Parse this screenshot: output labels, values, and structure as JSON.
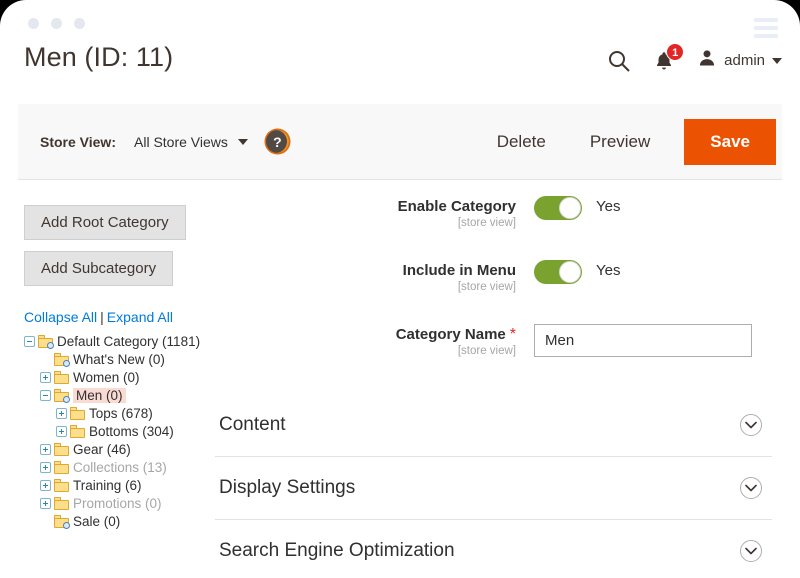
{
  "window": {
    "traffic_dots": 3,
    "menu_icon": "hamburger-icon"
  },
  "header": {
    "title": "Men (ID: 11)",
    "search_icon": "search-icon",
    "notifications_icon": "bell-icon",
    "notifications_count": "1",
    "user_icon": "user-avatar-icon",
    "user_name": "admin",
    "user_caret": "chevron-down-icon"
  },
  "storeview": {
    "label": "Store View:",
    "value": "All Store Views",
    "help_icon": "question-mark-icon",
    "help_glyph": "?",
    "delete_label": "Delete",
    "preview_label": "Preview",
    "save_label": "Save",
    "save_color": "#eb5202"
  },
  "sidebar": {
    "add_root_label": "Add Root Category",
    "add_sub_label": "Add Subcategory",
    "collapse_all": "Collapse All",
    "separator": "|",
    "expand_all": "Expand All",
    "tree": [
      {
        "label": "Default Category (1181)",
        "depth": 0,
        "expander": "minus",
        "icon": "folder-search-icon",
        "selected": false,
        "disabled": false
      },
      {
        "label": "What's New (0)",
        "depth": 1,
        "expander": "none",
        "icon": "folder-search-icon",
        "selected": false,
        "disabled": false
      },
      {
        "label": "Women (0)",
        "depth": 1,
        "expander": "plus",
        "icon": "folder-icon",
        "selected": false,
        "disabled": false
      },
      {
        "label": "Men (0)",
        "depth": 1,
        "expander": "minus",
        "icon": "folder-search-icon",
        "selected": true,
        "disabled": false
      },
      {
        "label": "Tops (678)",
        "depth": 2,
        "expander": "plus",
        "icon": "folder-icon",
        "selected": false,
        "disabled": false
      },
      {
        "label": "Bottoms (304)",
        "depth": 2,
        "expander": "plus",
        "icon": "folder-icon",
        "selected": false,
        "disabled": false
      },
      {
        "label": "Gear (46)",
        "depth": 1,
        "expander": "plus",
        "icon": "folder-icon",
        "selected": false,
        "disabled": false
      },
      {
        "label": "Collections (13)",
        "depth": 1,
        "expander": "plus",
        "icon": "folder-icon",
        "selected": false,
        "disabled": true
      },
      {
        "label": "Training (6)",
        "depth": 1,
        "expander": "plus",
        "icon": "folder-icon",
        "selected": false,
        "disabled": false
      },
      {
        "label": "Promotions (0)",
        "depth": 1,
        "expander": "plus",
        "icon": "folder-icon",
        "selected": false,
        "disabled": true
      },
      {
        "label": "Sale (0)",
        "depth": 1,
        "expander": "none",
        "icon": "folder-search-icon",
        "selected": false,
        "disabled": false
      }
    ],
    "selected_highlight": "#fadbd3"
  },
  "form": {
    "enable_category": {
      "label": "Enable Category",
      "scope": "[store view]",
      "value": "Yes",
      "on": true
    },
    "include_in_menu": {
      "label": "Include in Menu",
      "scope": "[store view]",
      "value": "Yes",
      "on": true
    },
    "category_name": {
      "label": "Category Name",
      "required_marker": "*",
      "scope": "[store view]",
      "value": "Men",
      "placeholder": ""
    },
    "toggle_on_color": "#79a22e"
  },
  "sections": [
    {
      "title": "Content",
      "icon": "chevron-down-icon",
      "expanded": false
    },
    {
      "title": "Display Settings",
      "icon": "chevron-down-icon",
      "expanded": false
    },
    {
      "title": "Search Engine Optimization",
      "icon": "chevron-down-icon",
      "expanded": false
    }
  ]
}
